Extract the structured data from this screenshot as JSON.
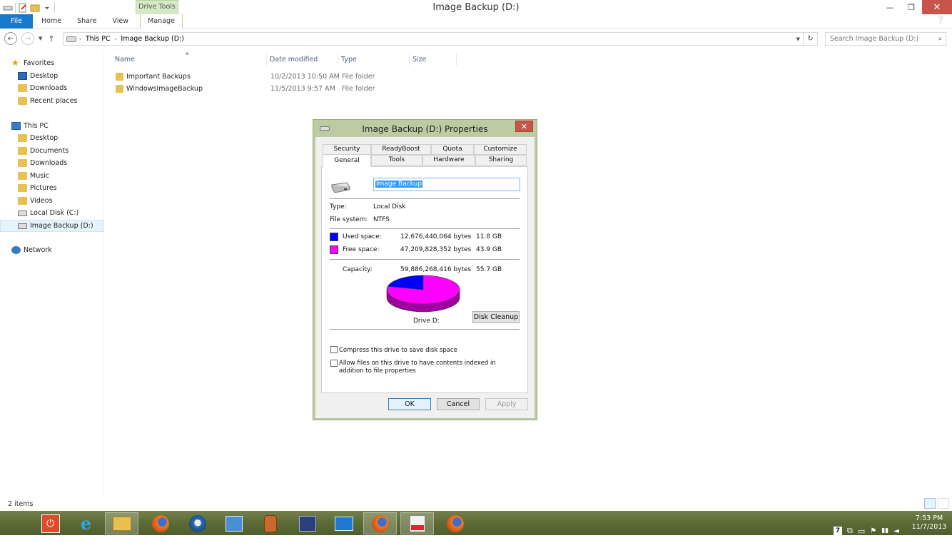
{
  "window": {
    "title": "Image Backup (D:)",
    "context_tab": "Drive Tools",
    "minimize": "—",
    "restore": "❐",
    "close": "✕"
  },
  "ribbon": {
    "tabs": [
      "File",
      "Home",
      "Share",
      "View",
      "Manage"
    ]
  },
  "address": {
    "crumbs": [
      "This PC",
      "Image Backup (D:)"
    ],
    "search_placeholder": "Search Image Backup (D:)"
  },
  "nav": {
    "favorites": "Favorites",
    "fav_items": [
      "Desktop",
      "Downloads",
      "Recent places"
    ],
    "thispc": "This PC",
    "pc_items": [
      "Desktop",
      "Documents",
      "Downloads",
      "Music",
      "Pictures",
      "Videos",
      "Local Disk (C:)",
      "Image Backup (D:)"
    ],
    "network": "Network"
  },
  "files": {
    "columns": [
      "Name",
      "Date modified",
      "Type",
      "Size"
    ],
    "rows": [
      {
        "name": "Important Backups",
        "date": "10/2/2013 10:50 AM",
        "type": "File folder"
      },
      {
        "name": "WindowsImageBackup",
        "date": "11/5/2013 9:57 AM",
        "type": "File folder"
      }
    ]
  },
  "status": {
    "items": "2 items"
  },
  "dialog": {
    "title": "Image Backup (D:) Properties",
    "close": "✕",
    "tabs_row1": [
      "Security",
      "ReadyBoost",
      "Quota",
      "Customize"
    ],
    "tabs_row2": [
      "General",
      "Tools",
      "Hardware",
      "Sharing"
    ],
    "label_value": "Image Backup",
    "type_label": "Type:",
    "type_value": "Local Disk",
    "fs_label": "File system:",
    "fs_value": "NTFS",
    "used_label": "Used space:",
    "used_bytes": "12,676,440,064 bytes",
    "used_gb": "11.8 GB",
    "free_label": "Free space:",
    "free_bytes": "47,209,828,352 bytes",
    "free_gb": "43.9 GB",
    "cap_label": "Capacity:",
    "cap_bytes": "59,886,268,416 bytes",
    "cap_gb": "55.7 GB",
    "used_fraction": 0.2117,
    "used_color": "#0000ff",
    "free_color": "#ff00ff",
    "drive_label": "Drive D:",
    "cleanup": "Disk Cleanup",
    "compress": "Compress this drive to save disk space",
    "index": "Allow files on this drive to have contents indexed in addition to file properties",
    "ok": "OK",
    "cancel": "Cancel",
    "apply": "Apply"
  },
  "tray": {
    "time": "7:53 PM",
    "date": "11/7/2013"
  }
}
